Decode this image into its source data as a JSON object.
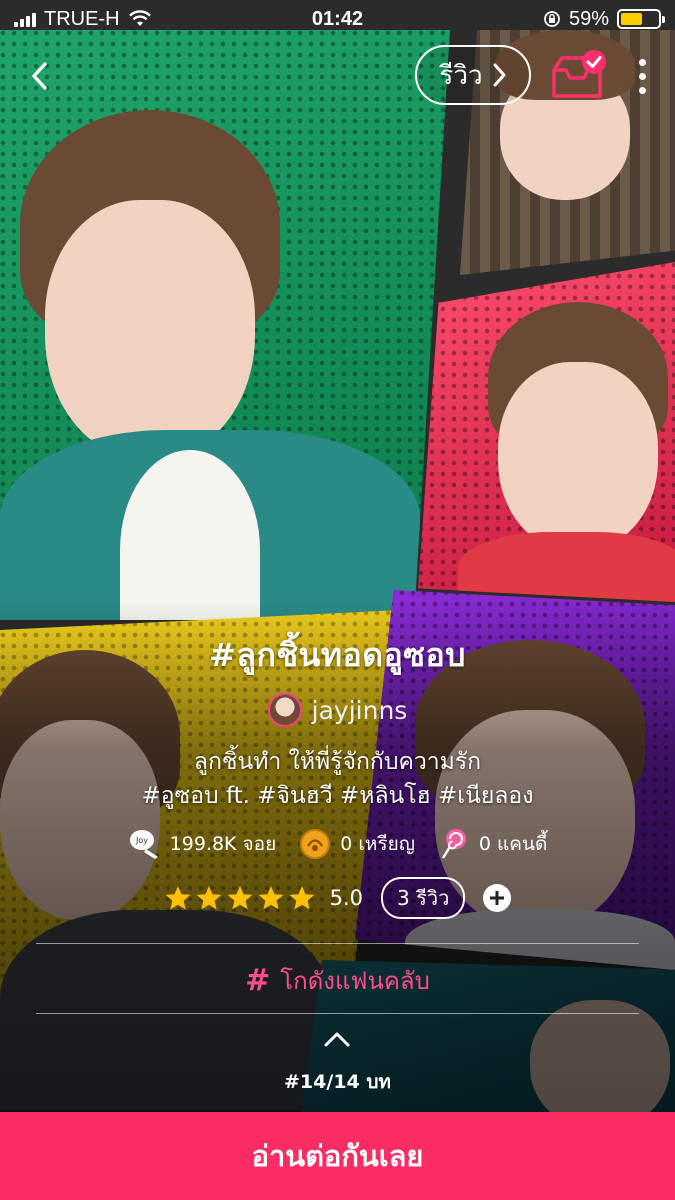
{
  "status_bar": {
    "carrier": "TRUE-H",
    "time": "01:42",
    "battery_percent": "59%",
    "battery_level": 0.59,
    "battery_color": "#ffcc00"
  },
  "nav": {
    "back_icon": "chevron-left-icon",
    "review_label": "รีวิว",
    "inbox_icon": "inbox-check-icon",
    "more_icon": "more-vertical-icon"
  },
  "story": {
    "title": "#ลูกชิ้นทอดอูซอบ",
    "author": "jayjinns",
    "description_line1": "ลูกชิ้นทำ ให้พี่รู้จักกับความรัก",
    "description_line2": "#อูซอบ ft. #จินฮวี #หลินโฮ #เนียลอง"
  },
  "stats": {
    "reads": "199.8K จอย",
    "coins": "0 เหรียญ",
    "candy": "0 แคนดี้"
  },
  "rating": {
    "stars": 5,
    "score": "5.0",
    "reviews_label": "3 รีวิว"
  },
  "fanclub_label": "โกดังแฟนคลับ",
  "episode_label": "#14/14 บท",
  "cta_label": "อ่านต่อกันเลย",
  "colors": {
    "accent": "#fb2c64",
    "fanclub": "#ff4d8a",
    "star": "#ffc107"
  }
}
